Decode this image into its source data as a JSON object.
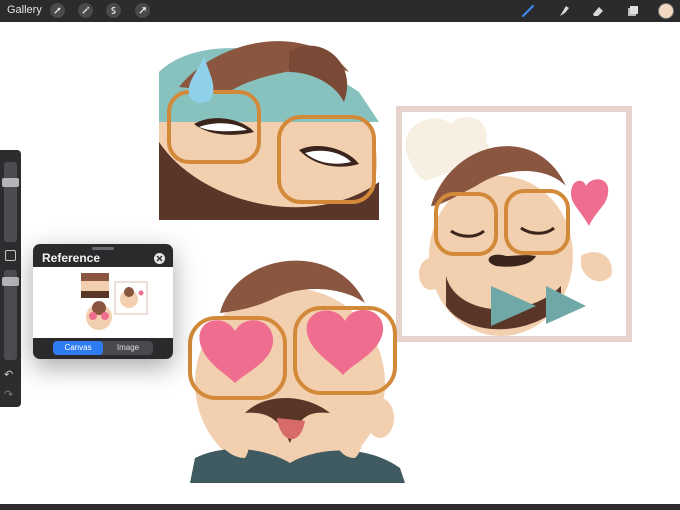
{
  "toolbar": {
    "gallery_label": "Gallery",
    "left_tools": [
      "wrench-icon",
      "magic-wand-icon",
      "selection-icon",
      "transform-icon"
    ],
    "right_tools": [
      "brush-icon",
      "smudge-icon",
      "eraser-icon",
      "layers-icon"
    ],
    "active_tool": "brush-icon",
    "accent_color": "#2f7bf1",
    "current_color": "#f0d9bf"
  },
  "sidebar": {
    "icons": [
      "modify-square-icon",
      "undo-icon",
      "redo-icon"
    ],
    "undo_symbol": "↶",
    "redo_symbol": "↷"
  },
  "reference_panel": {
    "title": "Reference",
    "tabs": [
      {
        "label": "Canvas",
        "active": true
      },
      {
        "label": "Image",
        "active": false
      }
    ]
  },
  "colors": {
    "skin": "#f2cfae",
    "hair": "#8a5640",
    "beard": "#5a3628",
    "glasses": "#d28a3a",
    "heart": "#ef6d8f",
    "bowtie": "#6fa8a6",
    "frame": "#e6d3cb",
    "sweat": "#8fd0ea"
  }
}
